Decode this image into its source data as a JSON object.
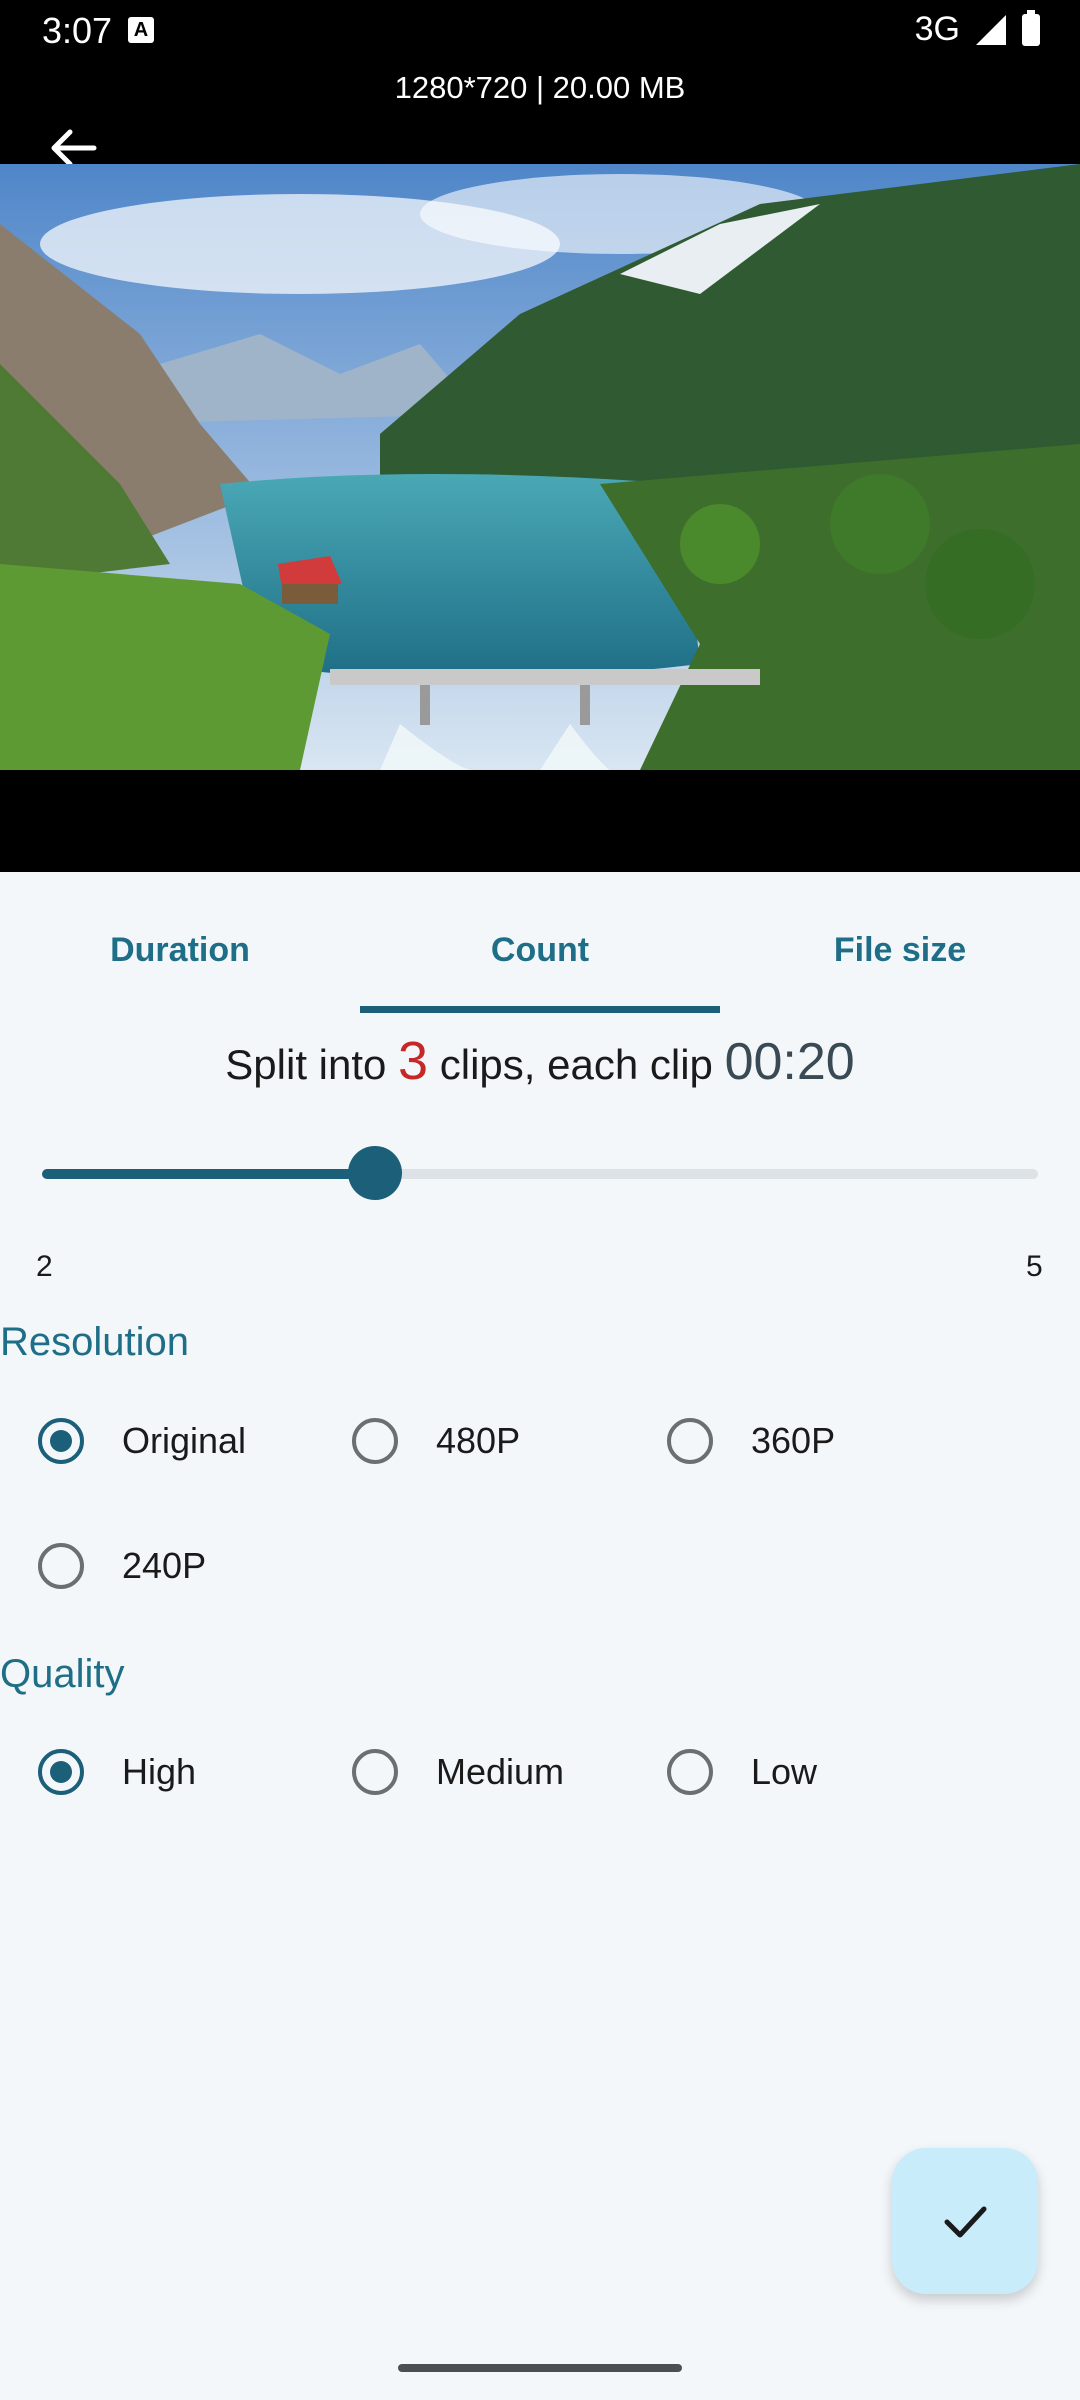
{
  "status_bar": {
    "time": "3:07",
    "network": "3G"
  },
  "video": {
    "info": "1280*720 | 20.00 MB"
  },
  "tabs": [
    {
      "label": "Duration"
    },
    {
      "label": "Count"
    },
    {
      "label": "File size"
    }
  ],
  "active_tab": "Count",
  "split_summary": {
    "prefix": "Split into ",
    "count": "3",
    "middle": " clips, each clip ",
    "clip_duration": "00:20"
  },
  "slider": {
    "min": "2",
    "max": "5",
    "value": 3
  },
  "resolution": {
    "title": "Resolution",
    "options": [
      "Original",
      "480P",
      "360P",
      "240P"
    ],
    "selected": "Original"
  },
  "quality": {
    "title": "Quality",
    "options": [
      "High",
      "Medium",
      "Low"
    ],
    "selected": "High"
  },
  "colors": {
    "accent": "#1b5f79",
    "highlight": "#c62828",
    "fab_bg": "#c9ecfb"
  }
}
